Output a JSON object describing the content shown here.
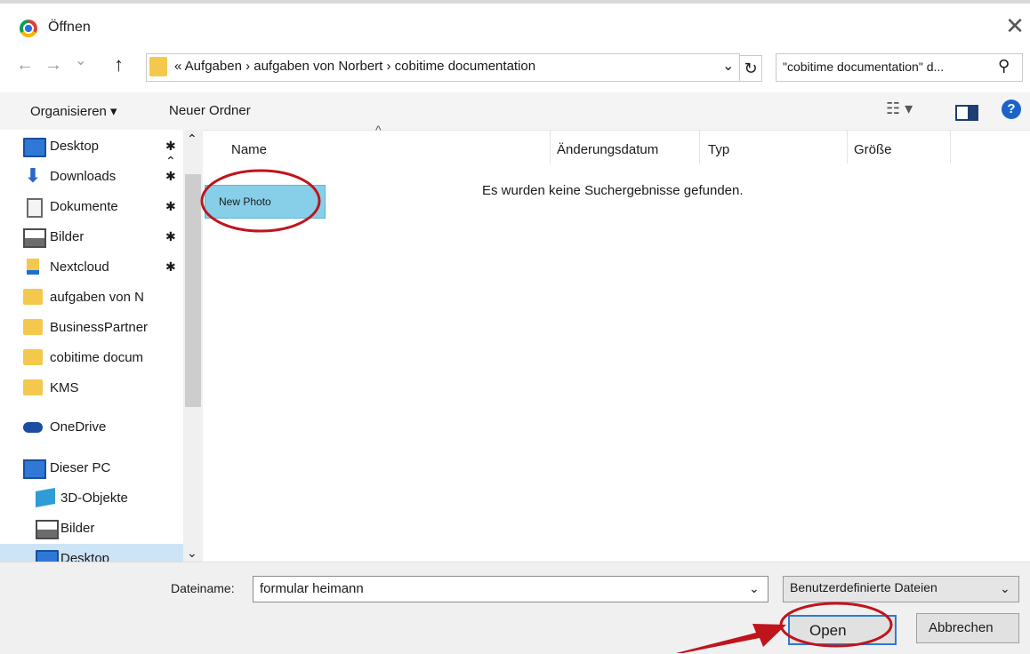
{
  "window": {
    "title": "Öffnen",
    "close_glyph": "✕"
  },
  "nav": {
    "back_glyph": "←",
    "forward_glyph": "→",
    "recent_glyph": "⌄",
    "up_glyph": "↑",
    "address": "« Aufgaben  ›  aufgaben von Norbert  ›  cobitime documentation",
    "address_drop": "⌄",
    "refresh_glyph": "↻",
    "search_value": "\"cobitime documentation\" d...",
    "search_glyph": "⚲"
  },
  "toolbar": {
    "organize": "Organisieren ▾",
    "new_folder": "Neuer Ordner",
    "views_glyph": "☷ ▾",
    "help_glyph": "?"
  },
  "sidebar": {
    "scroll_up": "⌃",
    "scroll_down": "⌄",
    "items": [
      {
        "label": "Desktop",
        "pin": "✱ ⌃",
        "icon": "desktop-icon"
      },
      {
        "label": "Downloads",
        "pin": "✱",
        "icon": "downloads-icon"
      },
      {
        "label": "Dokumente",
        "pin": "✱",
        "icon": "documents-icon"
      },
      {
        "label": "Bilder",
        "pin": "✱",
        "icon": "pictures-icon"
      },
      {
        "label": "Nextcloud",
        "pin": "✱",
        "icon": "nextcloud-icon"
      },
      {
        "label": "aufgaben von N",
        "pin": "",
        "icon": "folder-icon"
      },
      {
        "label": "BusinessPartner",
        "pin": "",
        "icon": "folder-icon"
      },
      {
        "label": "cobitime docum",
        "pin": "",
        "icon": "folder-icon"
      },
      {
        "label": "KMS",
        "pin": "",
        "icon": "folder-icon"
      },
      {
        "label": "OneDrive",
        "pin": "",
        "icon": "onedrive-icon"
      },
      {
        "label": "Dieser PC",
        "pin": "",
        "icon": "this-pc-icon"
      },
      {
        "label": "3D-Objekte",
        "pin": "",
        "icon": "3d-objects-icon"
      },
      {
        "label": "Bilder",
        "pin": "",
        "icon": "pictures-icon"
      },
      {
        "label": "Desktop",
        "pin": "",
        "icon": "desktop-icon"
      }
    ]
  },
  "columns": {
    "name": "Name",
    "modified": "Änderungsdatum",
    "type": "Typ",
    "size": "Größe",
    "sort_glyph": "^"
  },
  "content": {
    "drag_item": "New Photo",
    "empty_message": "Es wurden keine Suchergebnisse gefunden."
  },
  "footer": {
    "filename_label": "Dateiname:",
    "filename_value": "formular heimann",
    "filename_drop": "⌄",
    "filetype": "Benutzerdefinierte Dateien",
    "filetype_drop": "⌄",
    "open": "Open",
    "cancel": "Abbrechen"
  },
  "annotation_color": "#c0141c"
}
